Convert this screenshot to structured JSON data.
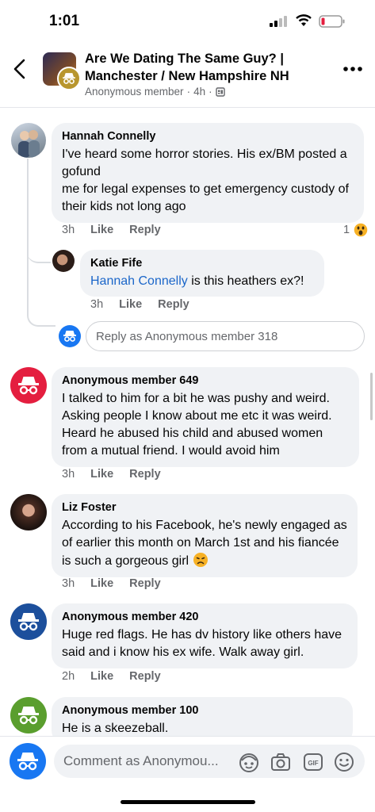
{
  "status_bar": {
    "time": "1:01"
  },
  "header": {
    "title": "Are We Dating The Same Guy? | Manchester / New Hampshire NH",
    "author": "Anonymous member",
    "age": "4h"
  },
  "comments": [
    {
      "name": "Hannah Connelly",
      "text": "I've heard some horror stories. His ex/BM posted a gofund\nme for legal expenses to get emergency custody of their kids not long ago",
      "time": "3h",
      "like": "Like",
      "reply": "Reply",
      "reaction_count": "1"
    },
    {
      "name": "Katie Fife",
      "mention": "Hannah Connelly",
      "text": " is this heathers ex?!",
      "time": "3h",
      "like": "Like",
      "reply": "Reply"
    },
    {
      "name": "Anonymous member 649",
      "text": "I talked to him for a bit he was pushy and weird. Asking people I know about me etc it was weird. Heard he abused his child and abused women from a mutual friend. I would avoid him",
      "time": "3h",
      "like": "Like",
      "reply": "Reply"
    },
    {
      "name": "Liz Foster",
      "text": "According to his Facebook, he's newly engaged as of earlier this month on March 1st and his fiancée is such a gorgeous girl",
      "time": "3h",
      "like": "Like",
      "reply": "Reply"
    },
    {
      "name": "Anonymous member 420",
      "text": "Huge red flags. He has dv history like others have said and i know his ex wife. Walk away girl.",
      "time": "2h",
      "like": "Like",
      "reply": "Reply"
    },
    {
      "name": "Anonymous member 100",
      "text": "He is a skeezeball."
    }
  ],
  "reply_box": {
    "placeholder": "Reply as Anonymous member 318"
  },
  "composer": {
    "placeholder": "Comment as Anonymou..."
  },
  "colors": {
    "anon_red": "#e41e3f",
    "anon_navy": "#1c4f9c",
    "anon_green": "#5a9e2e",
    "anon_blue": "#1877f2",
    "bubble": "#f0f2f5",
    "link": "#1b66c9"
  }
}
